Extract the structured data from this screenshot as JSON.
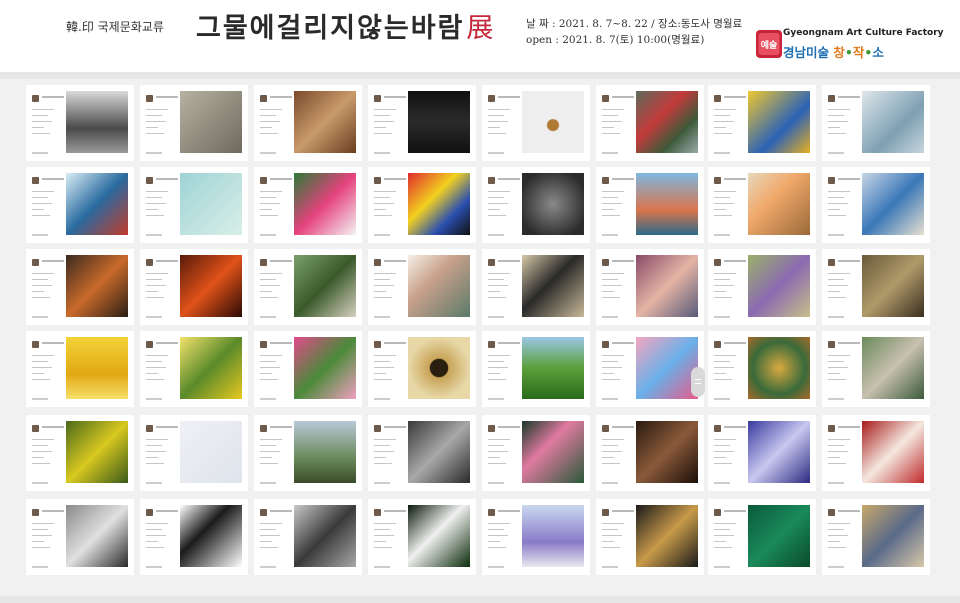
{
  "header": {
    "subtitle": "韓.印 국제문화교류",
    "title": "그물에걸리지않는바람",
    "title_suffix": "展",
    "date_line": "날 짜 : 2021. 8. 7~8. 22 / 장소:동도사 명월료",
    "open_line": "open : 2021. 8. 7(토) 10:00(명월료)"
  },
  "logo": {
    "mark_text": "예술",
    "name_en": "Gyeongnam Art Culture Factory",
    "name_ko_a": "경남미술 ",
    "name_ko_b": "창",
    "name_ko_dot1": "•",
    "name_ko_c": "작",
    "name_ko_dot2": "•",
    "name_ko_d": "소"
  },
  "colors": {
    "accent_red": "#c2283a",
    "logo_blue": "#1f6fb4",
    "logo_orange": "#e07a1c",
    "logo_green": "#3d9a3a",
    "panel_bg": "#ffffff",
    "grid_bg": "#f1f1f1"
  },
  "scrollbar": {
    "icon": "drag-handle-icon"
  }
}
